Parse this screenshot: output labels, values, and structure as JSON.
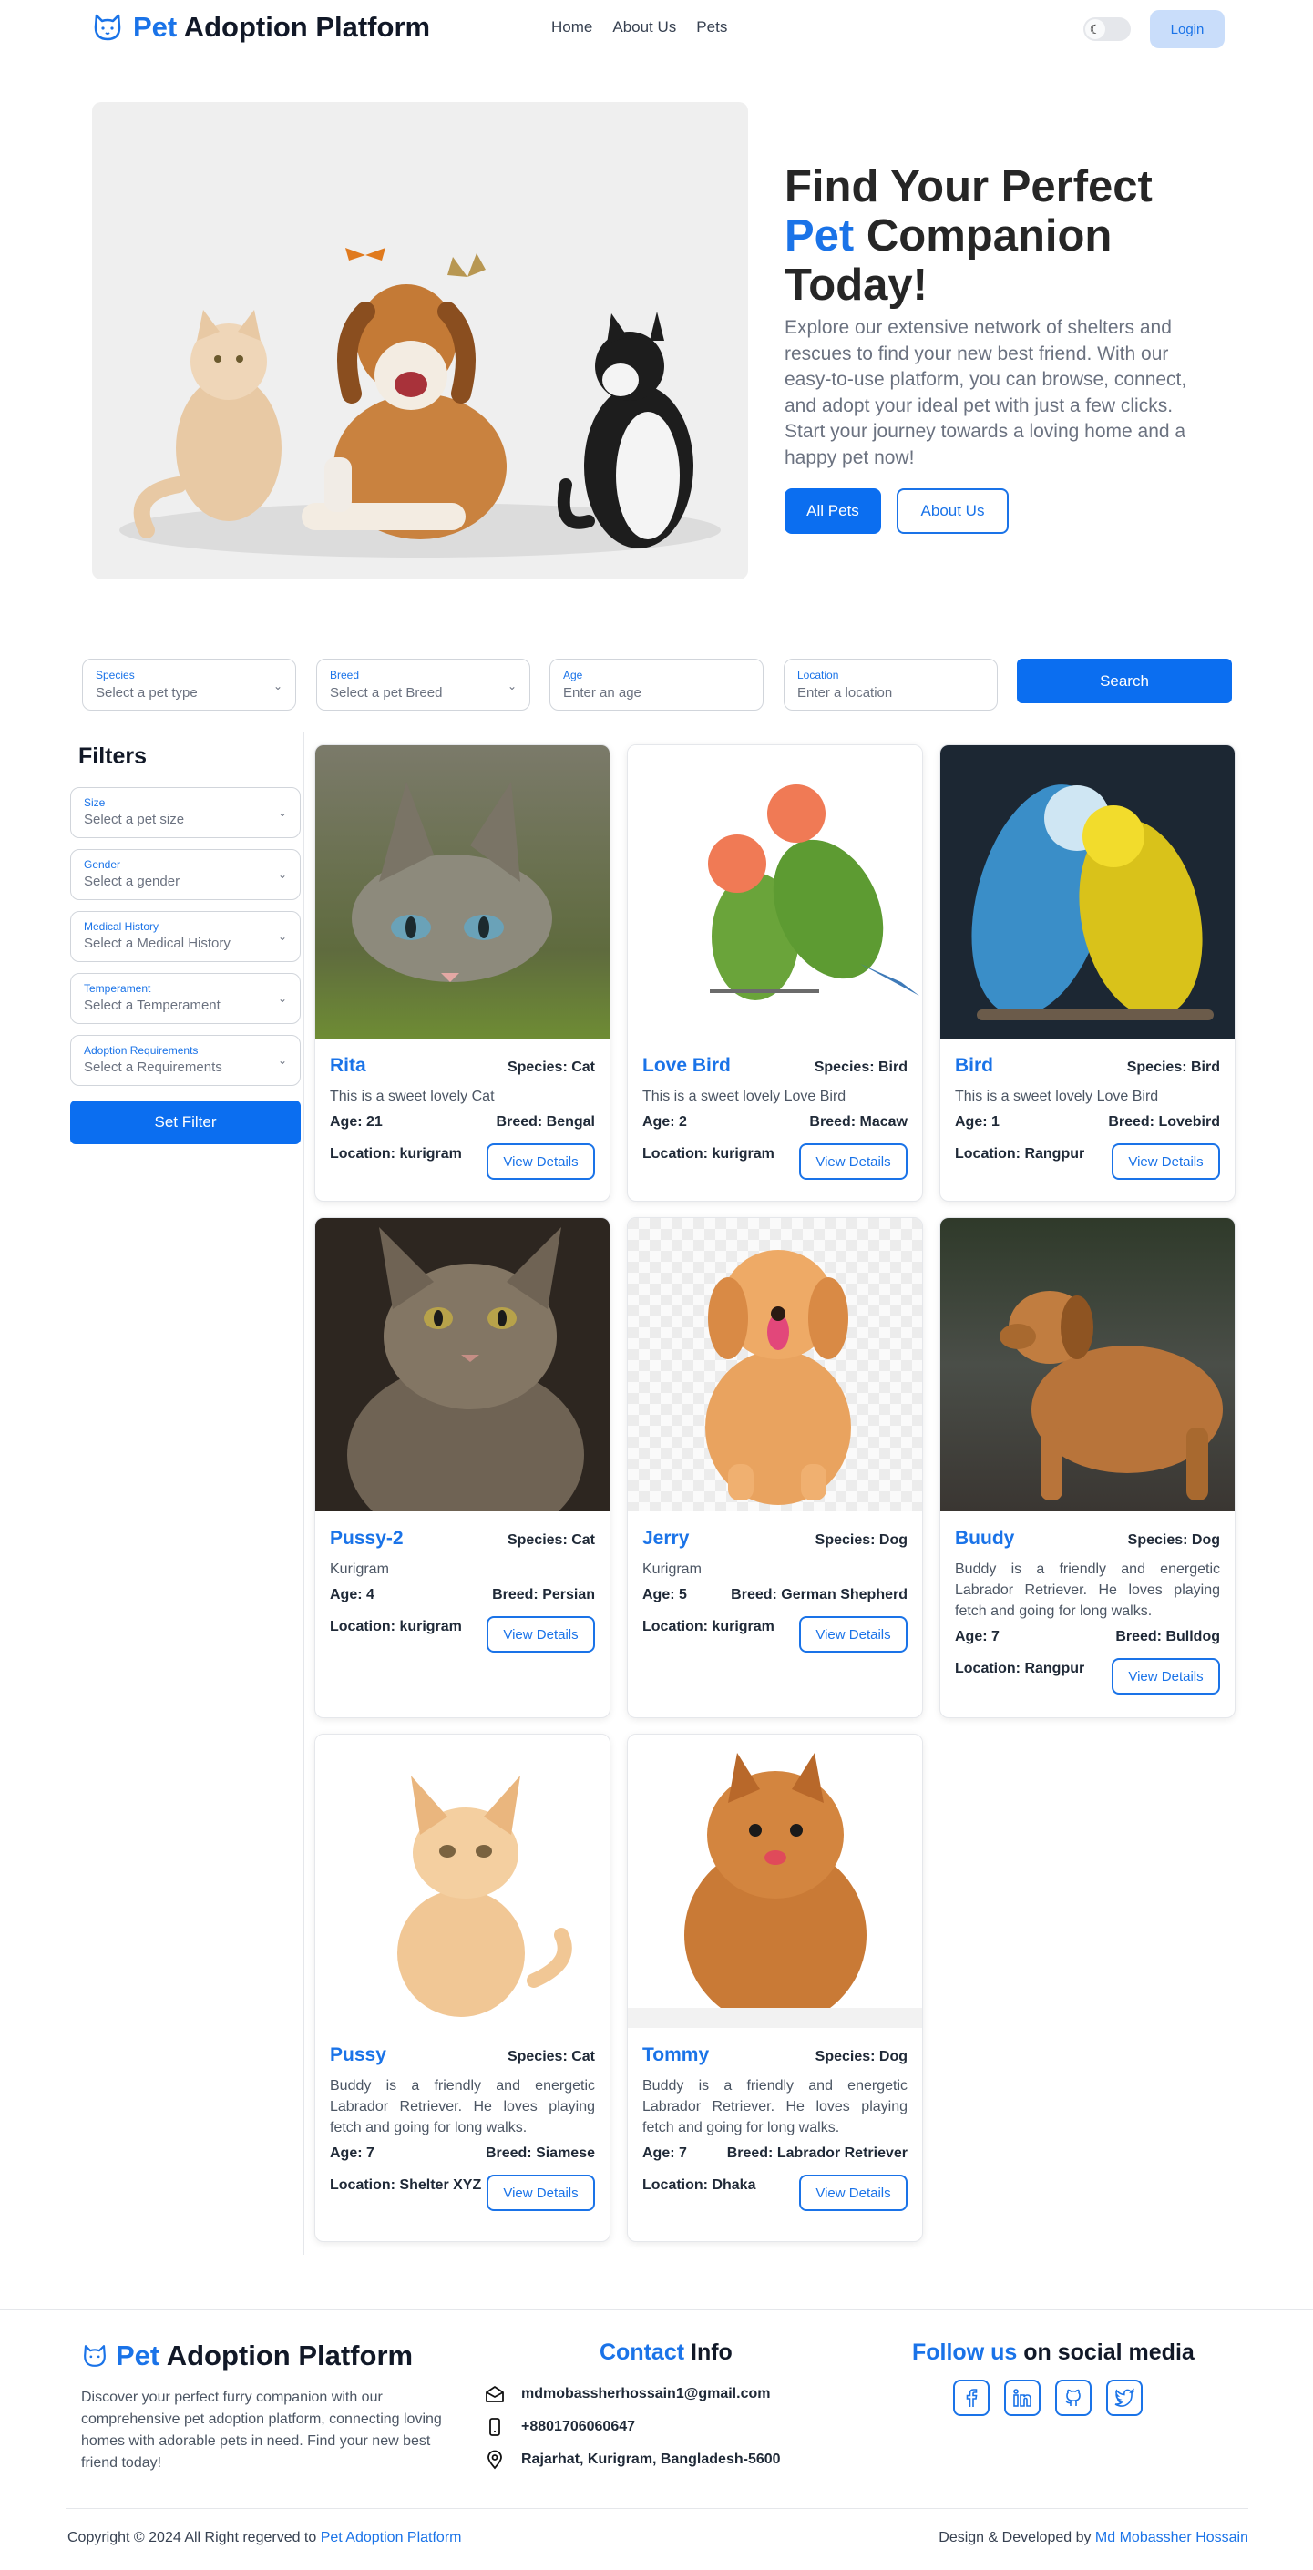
{
  "brand": {
    "highlight": "Pet",
    "rest": " Adoption Platform"
  },
  "nav": {
    "links": [
      "Home",
      "About Us",
      "Pets"
    ],
    "login": "Login"
  },
  "hero": {
    "title_line1": "Find Your Perfect",
    "title_highlight": "Pet",
    "title_line2_rest": " Companion",
    "title_line3": "Today!",
    "text": "Explore our extensive network of shelters and rescues to find your new best friend. With our easy-to-use platform, you can browse, connect, and adopt your ideal pet with just a few clicks. Start your journey towards a loving home and a happy pet now!",
    "btn_all": "All Pets",
    "btn_about": "About Us"
  },
  "search": {
    "fields": [
      {
        "label": "Species",
        "value": "Select a pet type",
        "dropdown": true
      },
      {
        "label": "Breed",
        "value": "Select a pet Breed",
        "dropdown": true
      },
      {
        "label": "Age",
        "value": "Enter an age",
        "dropdown": false
      },
      {
        "label": "Location",
        "value": "Enter a location",
        "dropdown": false
      }
    ],
    "button": "Search"
  },
  "filters": {
    "title": "Filters",
    "fields": [
      {
        "label": "Size",
        "value": "Select a pet size"
      },
      {
        "label": "Gender",
        "value": "Select a gender"
      },
      {
        "label": "Medical History",
        "value": "Select a Medical History"
      },
      {
        "label": "Temperament",
        "value": "Select a Temperament"
      },
      {
        "label": "Adoption Requirements",
        "value": "Select a Requirements"
      }
    ],
    "button": "Set Filter"
  },
  "pets": [
    {
      "name": "Rita",
      "species": "Species: Cat",
      "desc": "This is a sweet lovely Cat",
      "age": "Age: 21",
      "breed": "Breed: Bengal",
      "location": "Location: kurigram",
      "btn": "View Details",
      "photo": "tabby-kitten"
    },
    {
      "name": "Love Bird",
      "species": "Species: Bird",
      "desc": "This is a sweet lovely Love Bird",
      "age": "Age: 2",
      "breed": "Breed: Macaw",
      "location": "Location: kurigram",
      "btn": "View Details",
      "photo": "lovebirds"
    },
    {
      "name": "Bird",
      "species": "Species: Bird",
      "desc": "This is a sweet lovely Love Bird",
      "age": "Age: 1",
      "breed": "Breed: Lovebird",
      "location": "Location: Rangpur",
      "btn": "View Details",
      "photo": "budgies"
    },
    {
      "name": "Pussy-2",
      "species": "Species: Cat",
      "desc": "Kurigram",
      "age": "Age: 4",
      "breed": "Breed: Persian",
      "location": "Location: kurigram",
      "btn": "View Details",
      "photo": "tabby-cat"
    },
    {
      "name": "Jerry",
      "species": "Species: Dog",
      "desc": "Kurigram",
      "age": "Age: 5",
      "breed": "Breed: German Shepherd",
      "location": "Location: kurigram",
      "btn": "View Details",
      "photo": "golden-retriever"
    },
    {
      "name": "Buudy",
      "species": "Species: Dog",
      "desc": "Buddy is a friendly and energetic Labrador Retriever. He loves playing fetch and going for long walks.",
      "age": "Age: 7",
      "breed": "Breed: Bulldog",
      "location": "Location: Rangpur",
      "btn": "View Details",
      "photo": "labrador"
    },
    {
      "name": "Pussy",
      "species": "Species: Cat",
      "desc": "Buddy is a friendly and energetic Labrador Retriever. He loves playing fetch and going for long walks.",
      "age": "Age: 7",
      "breed": "Breed: Siamese",
      "location": "Location: Shelter XYZ",
      "btn": "View Details",
      "photo": "ginger-kitten"
    },
    {
      "name": "Tommy",
      "species": "Species: Dog",
      "desc": "Buddy is a friendly and energetic Labrador Retriever. He loves playing fetch and going for long walks.",
      "age": "Age: 7",
      "breed": "Breed: Labrador Retriever",
      "location": "Location: Dhaka",
      "btn": "View Details",
      "photo": "pomeranian"
    }
  ],
  "footer": {
    "text": "Discover your perfect furry companion with our comprehensive pet adoption platform, connecting loving homes with adorable pets in need. Find your new best friend today!",
    "contact_highlight": "Contact",
    "contact_rest": " Info",
    "email": "mdmobassherhossain1@gmail.com",
    "phone": "+8801706060647",
    "address": "Rajarhat, Kurigram, Bangladesh-5600",
    "social_highlight": "Follow us",
    "social_rest": " on social media",
    "social_icons": [
      "facebook-icon",
      "linkedin-icon",
      "github-icon",
      "twitter-icon"
    ],
    "copyright_prefix": "Copyright © 2024 All Right regerved to ",
    "copyright_link": "Pet Adoption Platform",
    "dev_prefix": "Design & Developed by ",
    "dev_link": "Md Mobassher Hossain"
  },
  "colors": {
    "accent": "#1a73e8",
    "button": "#0b6ef0",
    "login_bg": "#c9ddfa"
  }
}
